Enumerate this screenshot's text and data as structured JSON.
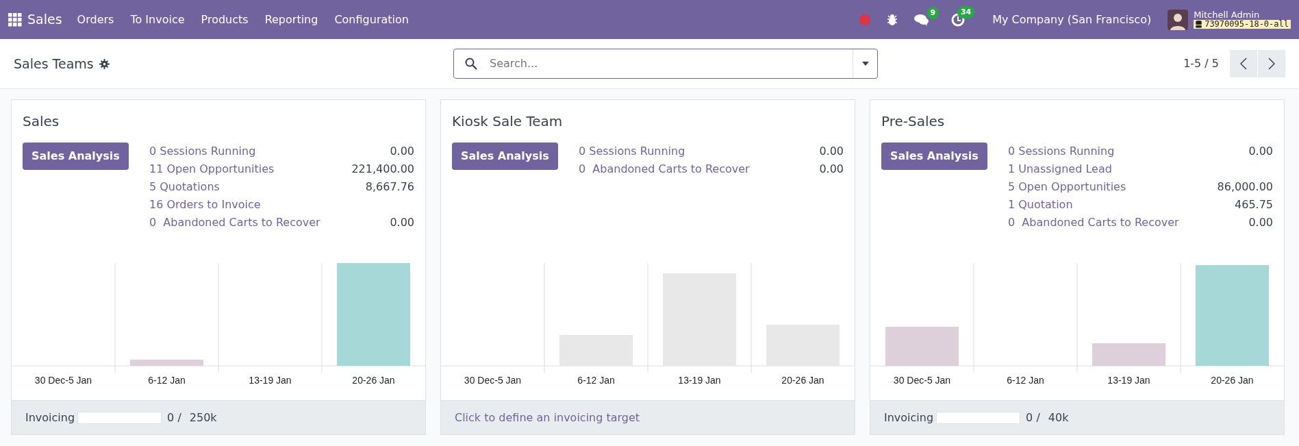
{
  "navbar": {
    "app": "Sales",
    "menu": [
      "Orders",
      "To Invoice",
      "Products",
      "Reporting",
      "Configuration"
    ],
    "messages_count": "9",
    "activities_count": "34",
    "company": "My Company (San Francisco)",
    "user": "Mitchell Admin",
    "database": "73970095-18-0-all"
  },
  "control_panel": {
    "title": "Sales Teams",
    "search": {
      "placeholder": "Search..."
    },
    "pager": "1-5 / 5"
  },
  "teams": [
    {
      "name": "Sales",
      "button": "Sales Analysis",
      "stats": [
        {
          "label": "0 Sessions Running",
          "value": "0.00"
        },
        {
          "label": "11 Open Opportunities",
          "value": "221,400.00"
        },
        {
          "label": "5 Quotations",
          "value": "8,667.76"
        },
        {
          "label": "16 Orders to Invoice"
        },
        {
          "label": "0  Abandoned Carts to Recover",
          "value": "0.00"
        }
      ],
      "chart_labels": [
        "30 Dec-5 Jan",
        "6-12 Jan",
        "13-19 Jan",
        "20-26 Jan"
      ],
      "footer": {
        "kind": "progress",
        "label": "Invoicing",
        "level": 0,
        "current": "0 /",
        "target": "250k"
      }
    },
    {
      "name": "Kiosk Sale Team",
      "button": "Sales Analysis",
      "stats": [
        {
          "label": "0 Sessions Running",
          "value": "0.00"
        },
        {
          "label": "0  Abandoned Carts to Recover",
          "value": "0.00"
        }
      ],
      "chart_labels": [
        "30 Dec-5 Jan",
        "6-12 Jan",
        "13-19 Jan",
        "20-26 Jan"
      ],
      "footer": {
        "kind": "link",
        "label": "Click to define an invoicing target"
      }
    },
    {
      "name": "Pre-Sales",
      "button": "Sales Analysis",
      "stats": [
        {
          "label": "0 Sessions Running",
          "value": "0.00"
        },
        {
          "label": "1 Unassigned Lead"
        },
        {
          "label": "5 Open Opportunities",
          "value": "86,000.00"
        },
        {
          "label": "1 Quotation",
          "value": "465.75"
        },
        {
          "label": "0  Abandoned Carts to Recover",
          "value": "0.00"
        }
      ],
      "chart_labels": [
        "30 Dec-5 Jan",
        "6-12 Jan",
        "13-19 Jan",
        "20-26 Jan"
      ],
      "footer": {
        "kind": "progress",
        "label": "Invoicing",
        "level": 0,
        "current": "0 /",
        "target": "40k"
      }
    }
  ]
}
